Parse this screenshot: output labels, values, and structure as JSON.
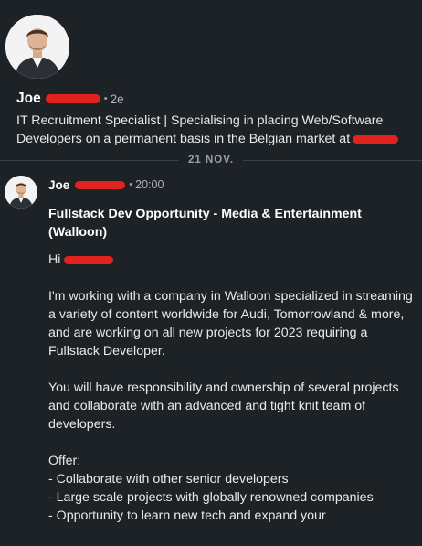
{
  "profile": {
    "first_name": "Joe",
    "meta_dot": "•",
    "connection_time": "2e",
    "headline": "IT Recruitment Specialist | Specialising in placing Web/Software Developers on a permanent basis in the Belgian market at"
  },
  "divider": {
    "date": "21 NOV."
  },
  "message": {
    "sender_first": "Joe",
    "meta_dot": "•",
    "time": "20:00",
    "subject": "Fullstack Dev Opportunity - Media & Entertainment (Walloon)",
    "greeting": "Hi",
    "paragraph1": "I'm working with a company in Walloon specialized in streaming a variety of content worldwide for Audi, Tomorrowland & more, and are working on all new projects for 2023 requiring a Fullstack Developer.",
    "paragraph2": "You will have responsibility and ownership of several projects and collaborate with an advanced and tight knit team of developers.",
    "offer_title": "Offer:",
    "offer_items": [
      "- Collaborate with other senior developers",
      "- Large scale projects with globally renowned companies",
      "- Opportunity to learn new tech and expand your"
    ]
  }
}
